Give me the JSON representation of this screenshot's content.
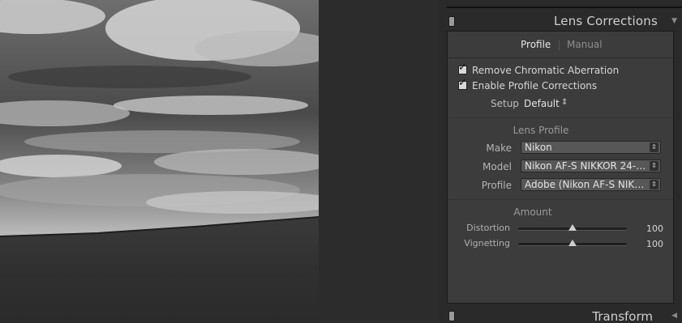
{
  "panel": {
    "title": "Lens Corrections",
    "collapse_icon": "triangle-down-icon"
  },
  "tabs": [
    {
      "label": "Profile",
      "active": true
    },
    {
      "label": "Manual",
      "active": false
    }
  ],
  "checkboxes": [
    {
      "label": "Remove Chromatic Aberration",
      "checked": true
    },
    {
      "label": "Enable Profile Corrections",
      "checked": true
    }
  ],
  "setup": {
    "label": "Setup",
    "value": "Default"
  },
  "lens_profile": {
    "title": "Lens Profile",
    "fields": [
      {
        "label": "Make",
        "value": "Nikon"
      },
      {
        "label": "Model",
        "value": "Nikon AF-S NIKKOR 24-70m..."
      },
      {
        "label": "Profile",
        "value": "Adobe (Nikon AF-S NIKKOR..."
      }
    ]
  },
  "amount": {
    "title": "Amount",
    "sliders": [
      {
        "label": "Distortion",
        "value": "100",
        "level": 0.5
      },
      {
        "label": "Vignetting",
        "value": "100",
        "level": 0.5
      }
    ]
  },
  "next_panel": {
    "title": "Transform",
    "expand_icon": "triangle-left-icon"
  }
}
